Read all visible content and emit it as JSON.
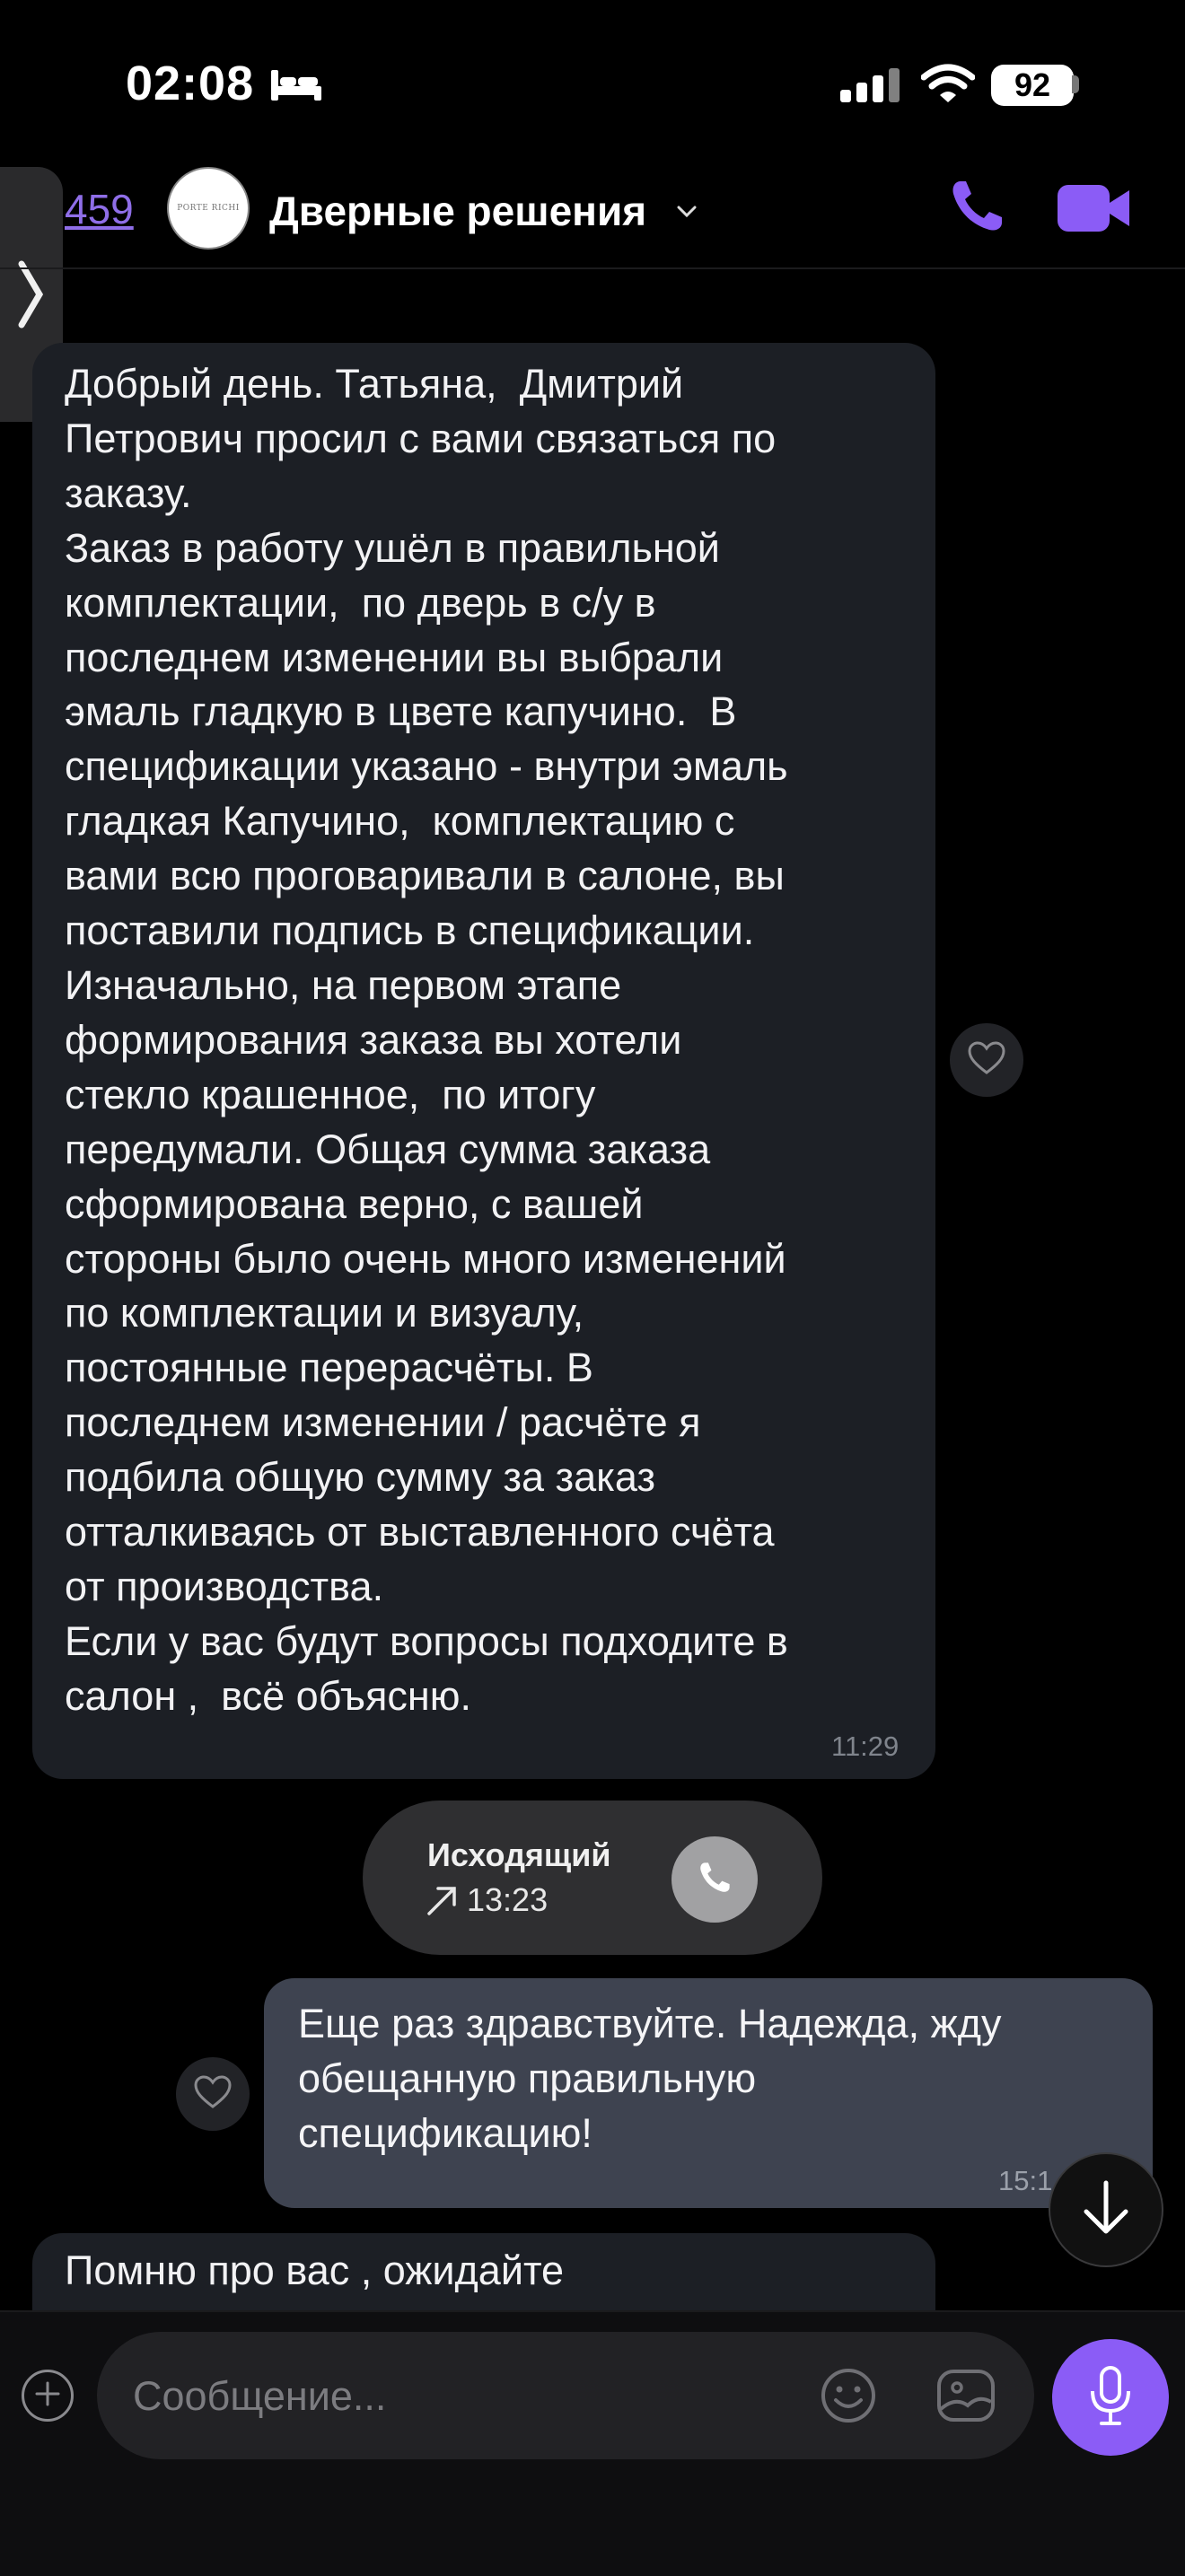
{
  "status_bar": {
    "time": "02:08",
    "battery": "92"
  },
  "header": {
    "unread_count": "459",
    "chat_name": "Дверные решения",
    "avatar_text": "PORTE RICHI"
  },
  "messages": [
    {
      "direction": "incoming",
      "text": "Добрый день. Татьяна,  Дмитрий\nПетрович просил с вами связаться по\nзаказу.\nЗаказ в работу ушёл в правильной\nкомплектации,  по дверь в с/у в\nпоследнем изменении вы выбрали\nэмаль гладкую в цвете капучино.  В\nспецификации указано - внутри эмаль\nгладкая Капучино,  комплектацию с\nвами всю проговаривали в салоне, вы\nпоставили подпись в спецификации.\nИзначально, на первом этапе\nформирования заказа вы хотели\nстекло крашенное,  по итогу\nпередумали. Общая сумма заказа\nсформирована верно, с вашей\nстороны было очень много изменений\nпо комплектации и визуалу,\nпостоянные перерасчёты. В\nпоследнем изменении / расчёте я\nподбила общую сумму за заказ\nотталкиваясь от выставленного счёта\nот производства.\nЕсли у вас будут вопросы подходите в\nсалон ,  всё объясню.",
      "time": "11:29"
    },
    {
      "direction": "outgoing",
      "text": "Еще раз здравствуйте. Надежда, жду\nобещанную правильную\nспецификацию!",
      "time": "15:1"
    },
    {
      "direction": "incoming",
      "text": "Помню про вас , ожидайте"
    }
  ],
  "call": {
    "type": "Исходящий",
    "time": "13:23"
  },
  "composer": {
    "placeholder": "Сообщение..."
  },
  "colors": {
    "accent": "#8b5cf6",
    "incoming_bubble": "#1c1f25",
    "outgoing_bubble": "#3e4350"
  }
}
